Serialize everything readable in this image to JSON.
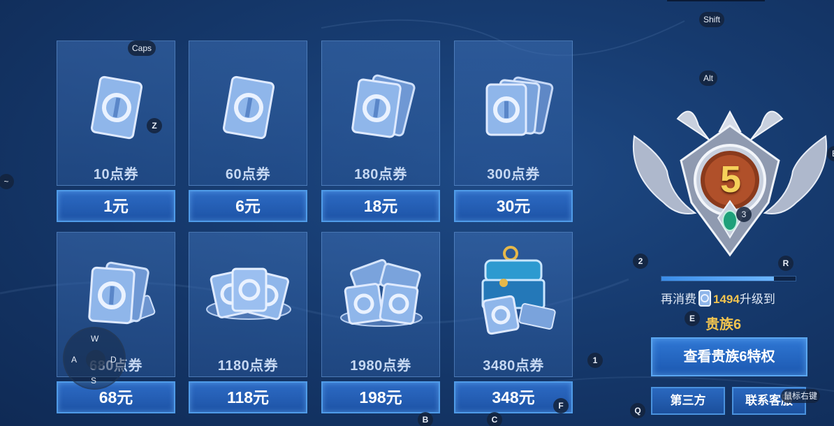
{
  "products": [
    {
      "name": "10点券",
      "price": "1元",
      "art": "single-card-icon"
    },
    {
      "name": "60点券",
      "price": "6元",
      "art": "single-card-icon"
    },
    {
      "name": "180点券",
      "price": "18元",
      "art": "two-cards-icon"
    },
    {
      "name": "300点券",
      "price": "30元",
      "art": "three-cards-icon"
    },
    {
      "name": "680点券",
      "price": "68元",
      "art": "card-stack-icon"
    },
    {
      "name": "1180点券",
      "price": "118元",
      "art": "card-pile-icon"
    },
    {
      "name": "1980点券",
      "price": "198元",
      "art": "card-heap-icon"
    },
    {
      "name": "3480点券",
      "price": "348元",
      "art": "treasure-chest-icon"
    }
  ],
  "noble": {
    "level": "5",
    "progress_fraction": 0.84,
    "upgrade_prefix": "再消费",
    "upgrade_cost": "1494",
    "upgrade_suffix": "升级到",
    "next_level": "贵族6",
    "view_privileges_button": "查看贵族6特权",
    "third_party_button": "第三方",
    "contact_service_button": "联系客服"
  },
  "key_overlays": {
    "caps": "Caps",
    "shift": "Shift",
    "alt": "Alt",
    "z": "Z",
    "tilde": "~",
    "e_edge": "E",
    "k2": "2",
    "r": "R",
    "k3": "3",
    "e": "E",
    "k1": "1",
    "f": "F",
    "b": "B",
    "c": "C",
    "q": "Q",
    "right_click": "鼠标右键",
    "joystick": {
      "w": "W",
      "a": "A",
      "s": "S",
      "d": "D"
    }
  },
  "colors": {
    "gold": "#f2c44f",
    "button_blue": "#2d6bc4",
    "background": "#163a6e"
  }
}
